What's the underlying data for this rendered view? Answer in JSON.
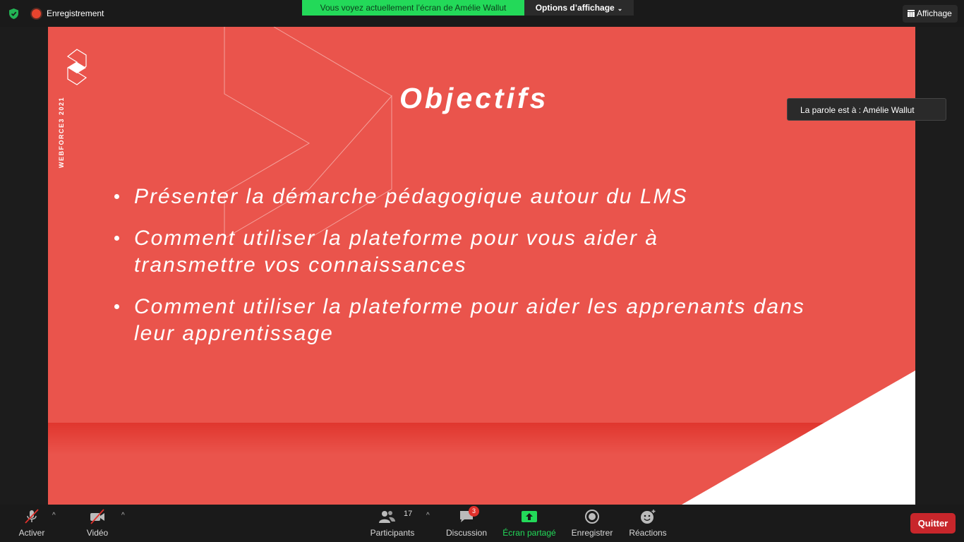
{
  "topbar": {
    "recording_label": "Enregistrement",
    "share_banner": "Vous voyez actuellement l’écran de Amélie Wallut",
    "view_options": "Options d’affichage",
    "view_button": "Affichage"
  },
  "slide": {
    "brand_vertical": "WEBFORCE3 2021",
    "title": "Objectifs",
    "bullets": [
      "Présenter la démarche pédagogique autour du LMS",
      "Comment utiliser la plateforme pour vous aider à transmettre vos connaissances",
      "Comment utiliser la plateforme pour aider les apprenants dans leur apprentissage"
    ]
  },
  "speaker": {
    "label": "La parole est à : Amélie Wallut"
  },
  "toolbar": {
    "mute_label": "Activer",
    "video_label": "Vidéo",
    "participants_label": "Participants",
    "participants_count": "17",
    "chat_label": "Discussion",
    "chat_badge": "3",
    "share_label": "Écran partagé",
    "record_label": "Enregistrer",
    "reactions_label": "Réactions",
    "quit_label": "Quitter"
  },
  "colors": {
    "slide_bg": "#ea544c",
    "share_green": "#23d959",
    "quit_red": "#c8262b"
  }
}
